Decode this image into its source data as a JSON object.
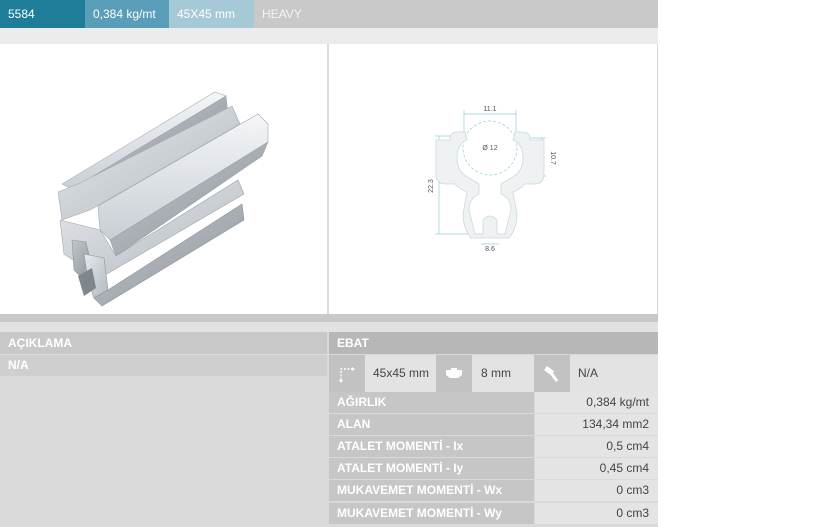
{
  "header": {
    "code": "5584",
    "weight": "0,384 kg/mt",
    "size": "45X45 mm",
    "type": "HEAVY"
  },
  "drawing": {
    "top_width": "11.1",
    "diameter": "Ø 12",
    "height": "22.3",
    "side": "10.7",
    "bottom_width": "8.6"
  },
  "description": {
    "heading": "AÇIKLAMA",
    "value": "N/A"
  },
  "specs": {
    "heading": "EBAT",
    "icons": [
      {
        "icon": "dimension-icon",
        "value": "45x45 mm"
      },
      {
        "icon": "slot-icon",
        "value": "8 mm"
      },
      {
        "icon": "bolt-icon",
        "value": "N/A"
      }
    ],
    "rows": [
      {
        "label": "AĞIRLIK",
        "value": "0,384 kg/mt"
      },
      {
        "label": "ALAN",
        "value": "134,34 mm2"
      },
      {
        "label": "ATALET MOMENTİ - Ix",
        "value": "0,5 cm4"
      },
      {
        "label": "ATALET MOMENTİ - Iy",
        "value": "0,45 cm4"
      },
      {
        "label": "MUKAVEMET MOMENTİ - Wx",
        "value": "0 cm3"
      },
      {
        "label": "MUKAVEMET MOMENTİ - Wy",
        "value": "0 cm3"
      }
    ]
  }
}
